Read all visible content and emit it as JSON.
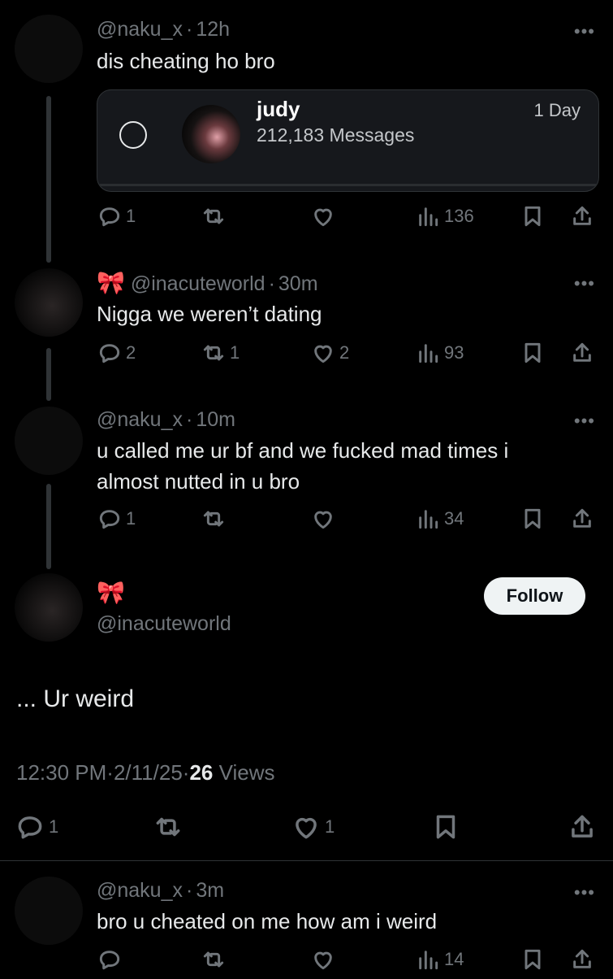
{
  "posts": [
    {
      "handle": "@naku_x",
      "time": "12h",
      "text": "dis cheating ho bro",
      "poll": {
        "name": "judy",
        "subtitle": "212,183 Messages",
        "duration": "1 Day"
      },
      "actions": {
        "replies": "1",
        "reposts": "",
        "likes": "",
        "views": "136"
      }
    },
    {
      "badge": "🎀",
      "handle": "@inacuteworld",
      "time": "30m",
      "text": "Nigga we weren’t dating",
      "actions": {
        "replies": "2",
        "reposts": "1",
        "likes": "2",
        "views": "93"
      }
    },
    {
      "handle": "@naku_x",
      "time": "10m",
      "text_line1": "u called me ur bf and we fucked mad times i",
      "text_line2": "almost nutted in u bro",
      "actions": {
        "replies": "1",
        "reposts": "",
        "likes": "",
        "views": "34"
      }
    }
  ],
  "main": {
    "badge": "🎀",
    "handle": "@inacuteworld",
    "follow_label": "Follow",
    "text": "... Ur weird",
    "time": "12:30 PM",
    "date": "2/11/25",
    "views_count": "26",
    "views_label": "Views",
    "actions": {
      "replies": "1",
      "likes": "1"
    }
  },
  "reply": {
    "handle": "@naku_x",
    "time": "3m",
    "text": "bro u cheated on me how am i weird",
    "actions": {
      "views": "14"
    }
  },
  "more_label": "•••",
  "separator": "·",
  "icons": [
    "reply-icon",
    "repost-icon",
    "like-icon",
    "views-icon",
    "bookmark-icon",
    "share-icon",
    "more-icon"
  ]
}
